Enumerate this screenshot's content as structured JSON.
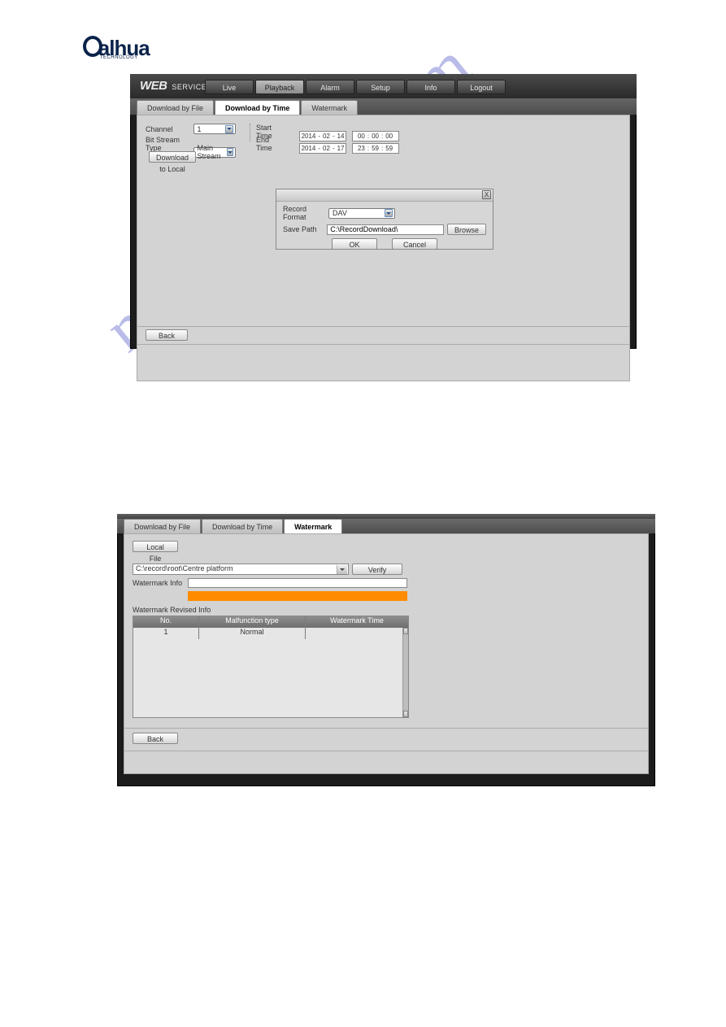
{
  "logo": {
    "main": "alhua",
    "sub": "TECHNOLOGY"
  },
  "watermark_diag": "manualshive.com",
  "shot1": {
    "brand_bold": "WEB",
    "brand_small": "SERVICE",
    "nav": {
      "live": "Live",
      "playback": "Playback",
      "alarm": "Alarm",
      "setup": "Setup",
      "info": "Info",
      "logout": "Logout"
    },
    "tabs": {
      "by_file": "Download by File",
      "by_time": "Download by Time",
      "watermark": "Watermark"
    },
    "form": {
      "channel_label": "Channel",
      "channel_value": "1",
      "bitstream_label": "Bit Stream Type",
      "bitstream_value": "Main Stream",
      "start_label": "Start Time",
      "end_label": "End Time",
      "start_date": {
        "y": "2014",
        "m": "02",
        "d": "14"
      },
      "start_time": {
        "h": "00",
        "m": "00",
        "s": "00"
      },
      "end_date": {
        "y": "2014",
        "m": "02",
        "d": "17"
      },
      "end_time": {
        "h": "23",
        "m": "59",
        "s": "59"
      },
      "download_local": "Download to Local",
      "back": "Back"
    },
    "modal": {
      "close": "X",
      "record_format_label": "Record Format",
      "record_format_value": "DAV",
      "save_path_label": "Save Path",
      "save_path_value": "C:\\RecordDownload\\",
      "browse": "Browse",
      "ok": "OK",
      "cancel": "Cancel"
    }
  },
  "shot2": {
    "tabs": {
      "by_file": "Download by File",
      "by_time": "Download by Time",
      "watermark": "Watermark"
    },
    "local_file": "Local File",
    "path_value": "C:\\record\\root\\Centre platform",
    "verify": "Verify",
    "watermark_info_label": "Watermark Info",
    "revised_label": "Watermark Revised Info",
    "table": {
      "h1": "No.",
      "h2": "Malfunction type",
      "h3": "Watermark Time",
      "row1_no": "1",
      "row1_type": "Normal",
      "row1_time": ""
    },
    "back": "Back"
  }
}
